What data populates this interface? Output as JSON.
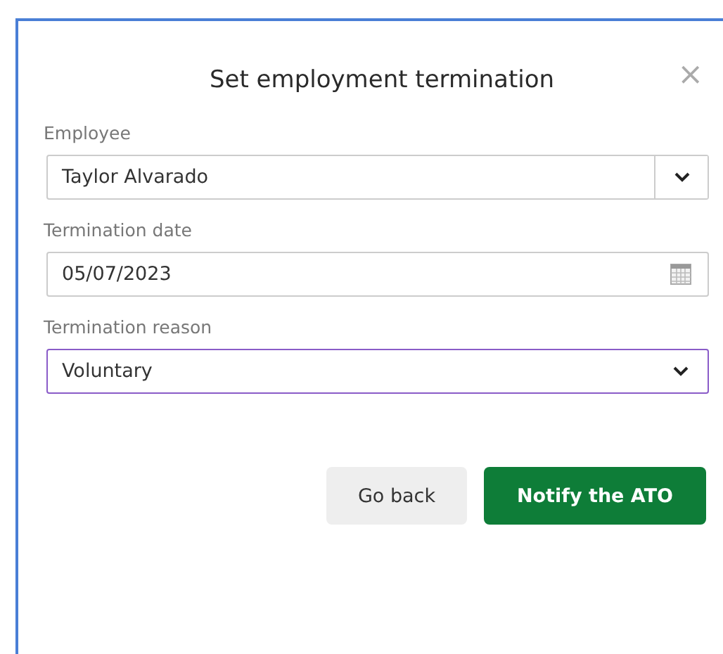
{
  "dialog": {
    "title": "Set employment termination",
    "close": "×"
  },
  "fields": [
    {
      "kind": "combo",
      "label": "Employee",
      "value": "Taylor Alvarado",
      "focused": false
    },
    {
      "kind": "date",
      "label": "Termination date",
      "value": "05/07/2023",
      "focused": false
    },
    {
      "kind": "select",
      "label": "Termination reason",
      "value": "Voluntary",
      "focused": true
    }
  ],
  "buttons": [
    {
      "label": "Go back",
      "kind": "secondary"
    },
    {
      "label": "Notify the ATO",
      "kind": "primary"
    }
  ]
}
